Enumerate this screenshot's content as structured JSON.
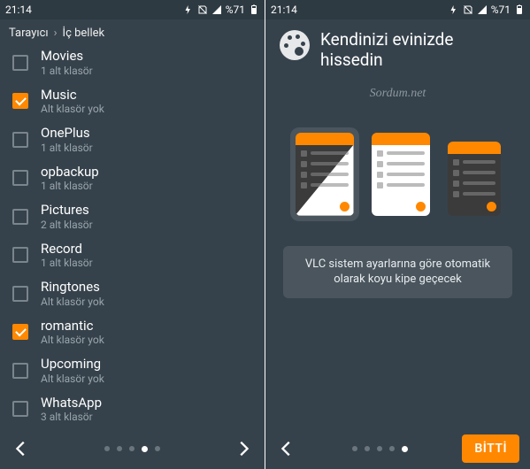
{
  "statusbar": {
    "time": "21:14",
    "battery_text": "%71"
  },
  "left": {
    "breadcrumb": {
      "root": "Tarayıcı",
      "current": "İç bellek"
    },
    "items": [
      {
        "label": "Movies",
        "sub": "1 alt klasör",
        "checked": false
      },
      {
        "label": "Music",
        "sub": "Alt klasör yok",
        "checked": true
      },
      {
        "label": "OnePlus",
        "sub": "1 alt klasör",
        "checked": false
      },
      {
        "label": "opbackup",
        "sub": "1 alt klasör",
        "checked": false
      },
      {
        "label": "Pictures",
        "sub": "2 alt klasör",
        "checked": false
      },
      {
        "label": "Record",
        "sub": "1 alt klasör",
        "checked": false
      },
      {
        "label": "Ringtones",
        "sub": "Alt klasör yok",
        "checked": false
      },
      {
        "label": "romantic",
        "sub": "Alt klasör yok",
        "checked": true
      },
      {
        "label": "Upcoming",
        "sub": "Alt klasör yok",
        "checked": false
      },
      {
        "label": "WhatsApp",
        "sub": "3 alt klasör",
        "checked": false
      }
    ],
    "pager": {
      "count": 5,
      "active": 3
    }
  },
  "right": {
    "title": "Kendinizi evinizde hissedin",
    "watermark": "Sordum.net",
    "info": "VLC sistem ayarlarına göre otomatik olarak koyu kipe geçecek",
    "done": "BİTTİ",
    "pager": {
      "count": 5,
      "active": 4
    }
  }
}
